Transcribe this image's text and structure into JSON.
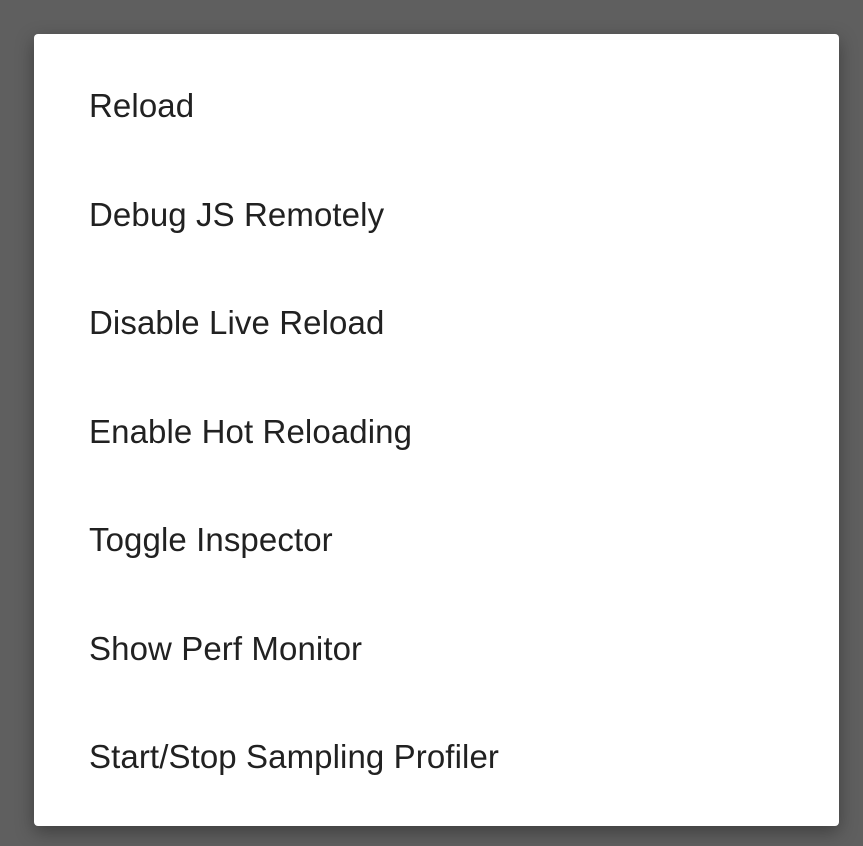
{
  "dev_menu": {
    "items": [
      {
        "label": "Reload"
      },
      {
        "label": "Debug JS Remotely"
      },
      {
        "label": "Disable Live Reload"
      },
      {
        "label": "Enable Hot Reloading"
      },
      {
        "label": "Toggle Inspector"
      },
      {
        "label": "Show Perf Monitor"
      },
      {
        "label": "Start/Stop Sampling Profiler"
      }
    ]
  },
  "colors": {
    "scrim": "#5f5f5f",
    "dialog_background": "#ffffff",
    "text": "#212121"
  }
}
